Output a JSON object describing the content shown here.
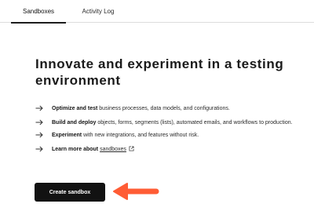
{
  "tabs": [
    {
      "label": "Sandboxes",
      "active": true
    },
    {
      "label": "Activity Log",
      "active": false
    }
  ],
  "main": {
    "title": "Innovate and experiment in a testing environment",
    "features": [
      {
        "bold": "Optimize and test",
        "text": " business processes, data models, and configurations."
      },
      {
        "bold": "Build and deploy",
        "text": " objects, forms, segments (lists), automated emails, and workflows to production."
      },
      {
        "bold": "Experiment",
        "text": " with new integrations, and features without risk."
      },
      {
        "bold": "Learn more about",
        "link": "sandboxes"
      }
    ],
    "create_button": "Create sandbox"
  },
  "icons": {
    "bullet": "arrow-right-icon",
    "external": "external-link-icon",
    "callout": "arrow-left-icon"
  },
  "colors": {
    "accent": "#ff5c35",
    "button_bg": "#121212",
    "button_text": "#ffffff"
  }
}
